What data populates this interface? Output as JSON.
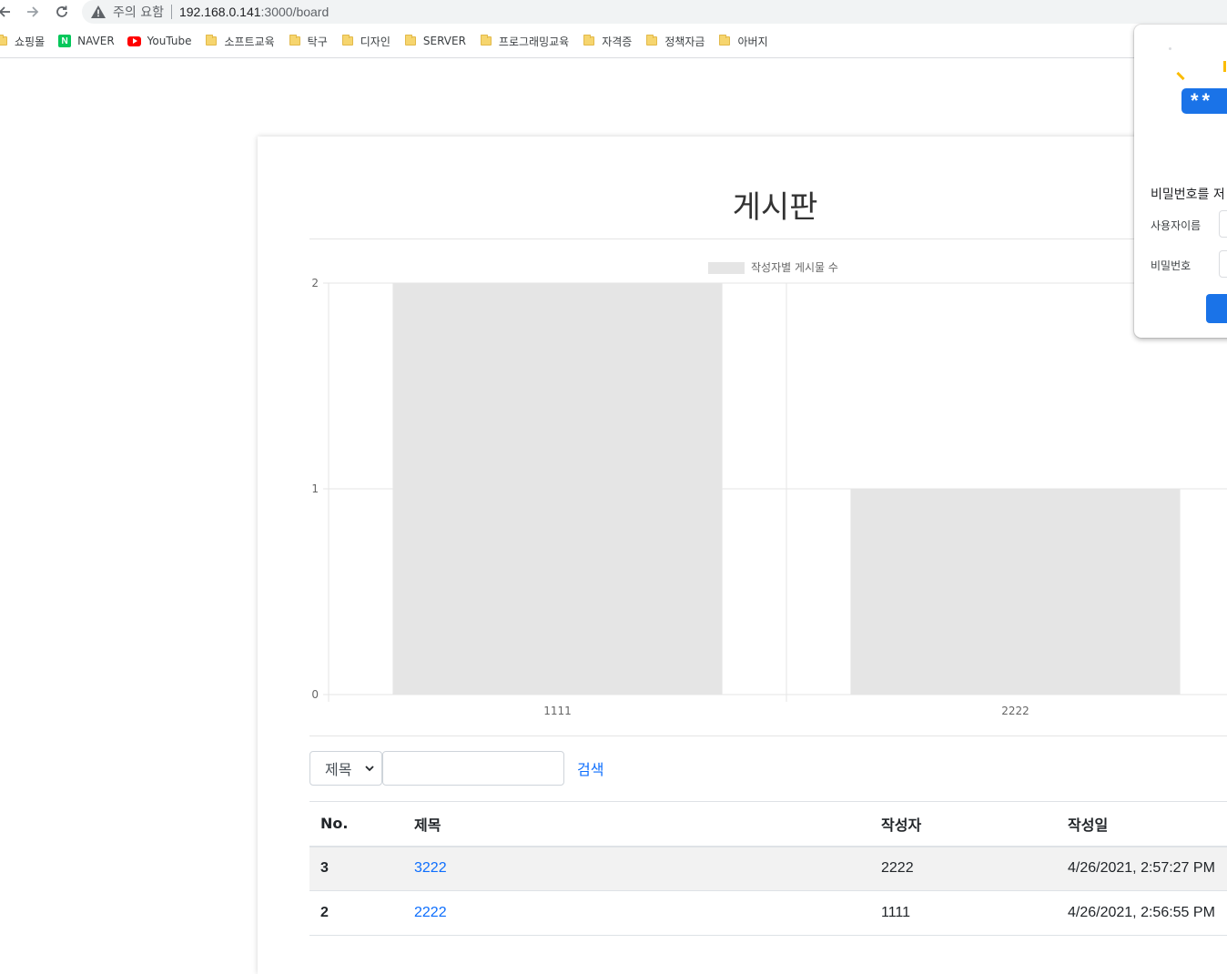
{
  "browser": {
    "security_label": "주의 요함",
    "url_host": "192.168.0.141",
    "url_rest": ":3000/board",
    "bookmarks": [
      {
        "label": "쇼핑몰",
        "icon": "folder-icon"
      },
      {
        "label": "NAVER",
        "icon": "naver-icon"
      },
      {
        "label": "YouTube",
        "icon": "youtube-icon"
      },
      {
        "label": "소프트교육",
        "icon": "folder-icon"
      },
      {
        "label": "탁구",
        "icon": "folder-icon"
      },
      {
        "label": "디자인",
        "icon": "folder-icon"
      },
      {
        "label": "SERVER",
        "icon": "folder-icon"
      },
      {
        "label": "프로그래밍교육",
        "icon": "folder-icon"
      },
      {
        "label": "자격증",
        "icon": "folder-icon"
      },
      {
        "label": "정책자금",
        "icon": "folder-icon"
      },
      {
        "label": "아버지",
        "icon": "folder-icon"
      }
    ]
  },
  "page": {
    "title": "게시판"
  },
  "chart_data": {
    "type": "bar",
    "categories": [
      "1111",
      "2222"
    ],
    "series": [
      {
        "name": "작성자별 게시물 수",
        "values": [
          2,
          1
        ]
      }
    ],
    "ylim": [
      0,
      2
    ],
    "yticks": [
      "0",
      "1",
      "2"
    ],
    "grid": true,
    "legend": "top",
    "bar_color": "#e5e5e5"
  },
  "search": {
    "selected_option": "제목",
    "input_value": "",
    "button_label": "검색"
  },
  "table": {
    "headers": [
      "No.",
      "제목",
      "작성자",
      "작성일"
    ],
    "rows": [
      {
        "no": "3",
        "title": "3222",
        "author": "2222",
        "date": "4/26/2021, 2:57:27 PM"
      },
      {
        "no": "2",
        "title": "2222",
        "author": "1111",
        "date": "4/26/2021, 2:56:55 PM"
      }
    ]
  },
  "password_popup": {
    "title": "비밀번호를 저",
    "username_label": "사용자이름",
    "password_label": "비밀번호",
    "illustration_text": "**"
  },
  "colors": {
    "link": "#0d6efd",
    "popup_accent": "#1a73e8",
    "bar": "#e5e5e5"
  }
}
